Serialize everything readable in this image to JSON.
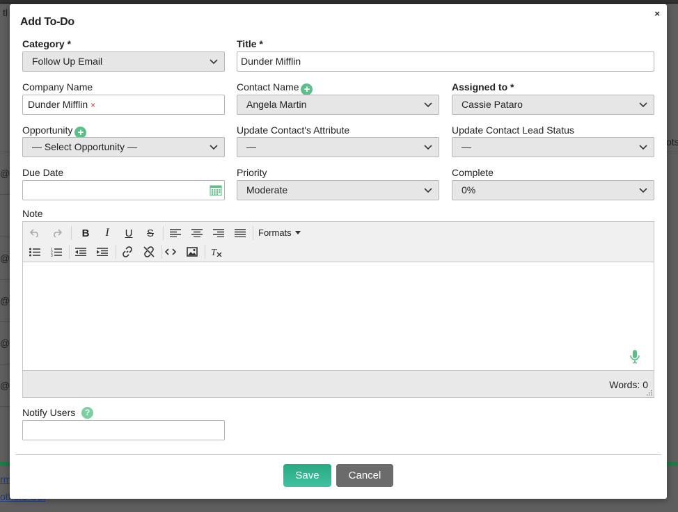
{
  "background": {
    "top_frag": "tl",
    "right_frag": "ots",
    "row_frag": "@",
    "link1": "rm",
    "link2": "others Out"
  },
  "modal": {
    "title": "Add To-Do",
    "close": "×"
  },
  "form": {
    "category": {
      "label": "Category *",
      "value": "Follow Up Email"
    },
    "title": {
      "label": "Title *",
      "value": "Dunder Mifflin"
    },
    "company": {
      "label": "Company Name",
      "tag": "Dunder Mifflin",
      "tag_remove": "×"
    },
    "contact": {
      "label": "Contact Name",
      "value": "Angela Martin"
    },
    "assigned": {
      "label": "Assigned to *",
      "value": "Cassie Pataro"
    },
    "opportunity": {
      "label": "Opportunity",
      "value": "— Select Opportunity —"
    },
    "contact_attribute": {
      "label": "Update Contact's Attribute",
      "value": "—"
    },
    "lead_status": {
      "label": "Update Contact Lead Status",
      "value": "—"
    },
    "due_date": {
      "label": "Due Date",
      "value": ""
    },
    "priority": {
      "label": "Priority",
      "value": "Moderate"
    },
    "complete": {
      "label": "Complete",
      "value": "0%"
    },
    "note": {
      "label": "Note",
      "formats_label": "Formats",
      "words": "Words: 0"
    },
    "notify": {
      "label": "Notify Users",
      "help": "?",
      "value": ""
    }
  },
  "actions": {
    "save": "Save",
    "cancel": "Cancel"
  },
  "colors": {
    "primary": "#2aa883",
    "secondary": "#6b6b6b",
    "accent_icon": "#5cbf8a"
  }
}
